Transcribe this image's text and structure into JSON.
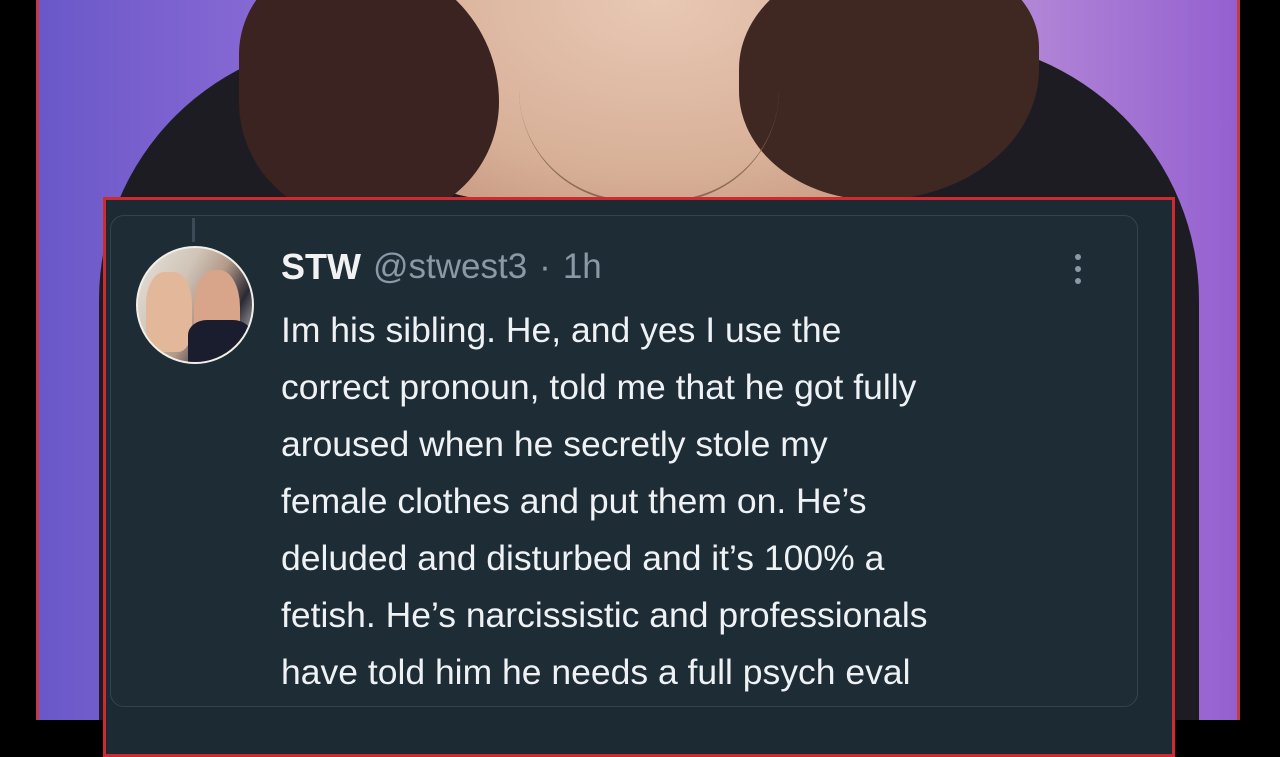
{
  "tweet": {
    "display_name": "STW",
    "handle": "@stwest3",
    "separator": "·",
    "time": "1h",
    "more_icon": "more-vertical-icon",
    "lines": [
      "Im his sibling. He, and yes I use the",
      "correct pronoun, told me that he got fully",
      "aroused when he secretly stole my",
      "female clothes and put them on. He’s",
      "deluded and disturbed and it’s 100% a",
      "fetish. He’s narcissistic and professionals",
      "have told him he needs a full psych eval"
    ]
  },
  "colors": {
    "highlight_border": "#cf2a30",
    "card_background": "#1e2c35",
    "text": "#eef2f5",
    "muted": "#8b98a5"
  }
}
